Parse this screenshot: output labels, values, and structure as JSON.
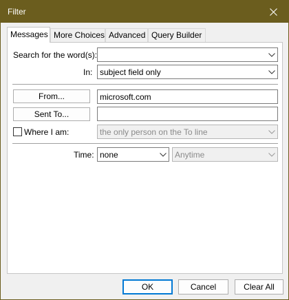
{
  "window": {
    "title": "Filter"
  },
  "tabs": [
    {
      "label": "Messages",
      "active": true
    },
    {
      "label": "More Choices"
    },
    {
      "label": "Advanced"
    },
    {
      "label": "Query Builder"
    }
  ],
  "messages": {
    "search_label": "Search for the word(s):",
    "search_value": "",
    "in_label": "In:",
    "in_value": "subject field only",
    "from_button": "From...",
    "from_value": "microsoft.com",
    "sent_to_button": "Sent To...",
    "sent_to_value": "",
    "where_label": "Where I am:",
    "where_checked": false,
    "where_value": "the only person on the To line",
    "time_label": "Time:",
    "time_value": "none",
    "time_range_value": "Anytime"
  },
  "footer": {
    "ok": "OK",
    "cancel": "Cancel",
    "clear_all": "Clear All"
  },
  "colors": {
    "titlebar": "#6b5d1e",
    "default_button_border": "#0078d4"
  }
}
